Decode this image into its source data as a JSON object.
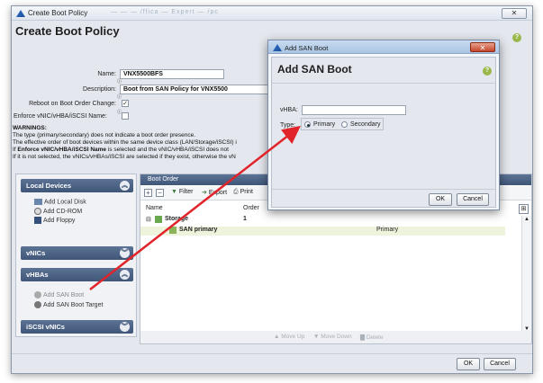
{
  "window": {
    "title": "Create Boot Policy",
    "blurred_title": "— — — /ffica — Expert — /pc",
    "close_symbol": "✕"
  },
  "header": {
    "title": "Create Boot Policy",
    "help": "?"
  },
  "form": {
    "name_label": "Name:",
    "name_value": "VNX5500BFS",
    "description_label": "Description:",
    "description_value": "Boot from SAN Policy for VNX5500",
    "reboot_label": "Reboot on Boot Order Change:",
    "reboot_checked": "✓",
    "enforce_label": "Enforce vNIC/vHBA/iSCSI Name:"
  },
  "warnings": {
    "title": "WARNINGS:",
    "line1": "The type (primary/secondary) does not indicate a boot order presence.",
    "line2": "The effective order of boot devices within the same device class (LAN/Storage/iSCSI) i",
    "line3_prefix": "If ",
    "line3_bold": "Enforce vNIC/vHBA/iSCSI Name",
    "line3_suffix": " is selected and the vNIC/vHBA/iSCSI does not",
    "line4": "If it is not selected, the vNICs/vHBAs/iSCSI are selected if they exist, otherwise the vN"
  },
  "left_panel": {
    "local_devices": "Local Devices",
    "add_local_disk": "Add Local Disk",
    "add_cdrom": "Add CD-ROM",
    "add_floppy": "Add Floppy",
    "vnics": "vNICs",
    "vhbas": "vHBAs",
    "add_san_boot": "Add SAN Boot",
    "add_san_boot_target": "Add SAN Boot Target",
    "iscsi_vnics": "iSCSI vNICs"
  },
  "boot_order": {
    "title": "Boot Order",
    "toolbar": {
      "add": "+",
      "remove": "−",
      "filter": "Filter",
      "export": "Export",
      "print": "Print"
    },
    "columns": {
      "name": "Name",
      "order": "Order"
    },
    "rows": [
      {
        "name": "Storage",
        "order": "1",
        "type": ""
      },
      {
        "name": "SAN primary",
        "order": "",
        "type": "Primary"
      }
    ],
    "move_up": "Move Up",
    "move_down": "Move Down",
    "delete": "Delete"
  },
  "footer": {
    "ok": "OK",
    "cancel": "Cancel"
  },
  "dialog": {
    "window_title": "Add SAN Boot",
    "title": "Add SAN Boot",
    "help": "?",
    "close_symbol": "✕",
    "vhba_label": "vHBA:",
    "vhba_value": "",
    "type_label": "Type:",
    "type_primary": "Primary",
    "type_secondary": "Secondary",
    "ok": "OK",
    "cancel": "Cancel"
  },
  "colors": {
    "accent": "#3f5678",
    "arrow": "#e0242a",
    "help": "#9ab84a"
  }
}
